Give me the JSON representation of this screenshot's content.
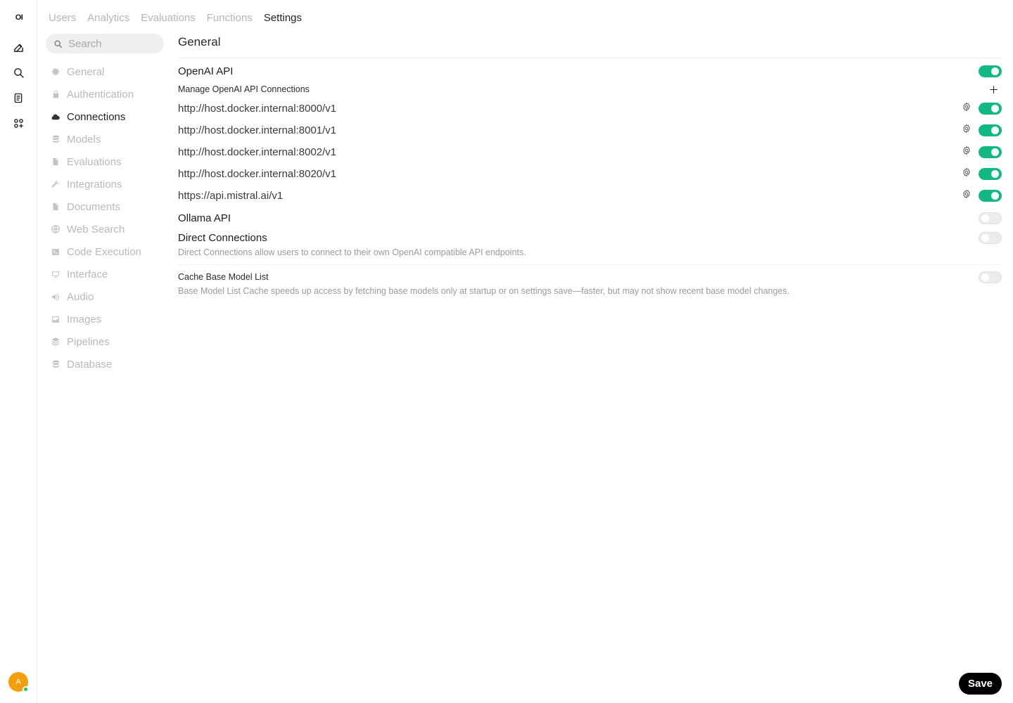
{
  "rail": {
    "logo": "OI",
    "avatar_initial": "A"
  },
  "top_tabs": [
    {
      "label": "Users",
      "active": false
    },
    {
      "label": "Analytics",
      "active": false
    },
    {
      "label": "Evaluations",
      "active": false
    },
    {
      "label": "Functions",
      "active": false
    },
    {
      "label": "Settings",
      "active": true
    }
  ],
  "search": {
    "placeholder": "Search"
  },
  "nav": [
    {
      "label": "General",
      "icon": "gear-icon",
      "active": false
    },
    {
      "label": "Authentication",
      "icon": "lock-icon",
      "active": false
    },
    {
      "label": "Connections",
      "icon": "cloud-icon",
      "active": true
    },
    {
      "label": "Models",
      "icon": "database-icon",
      "active": false
    },
    {
      "label": "Evaluations",
      "icon": "document-icon",
      "active": false
    },
    {
      "label": "Integrations",
      "icon": "wrench-icon",
      "active": false
    },
    {
      "label": "Documents",
      "icon": "document-icon",
      "active": false
    },
    {
      "label": "Web Search",
      "icon": "globe-icon",
      "active": false
    },
    {
      "label": "Code Execution",
      "icon": "terminal-icon",
      "active": false
    },
    {
      "label": "Interface",
      "icon": "monitor-icon",
      "active": false
    },
    {
      "label": "Audio",
      "icon": "speaker-icon",
      "active": false
    },
    {
      "label": "Images",
      "icon": "image-icon",
      "active": false
    },
    {
      "label": "Pipelines",
      "icon": "layers-icon",
      "active": false
    },
    {
      "label": "Database",
      "icon": "database-icon",
      "active": false
    }
  ],
  "main": {
    "section_title": "General",
    "openai": {
      "label": "OpenAI API",
      "enabled": true,
      "manage_label": "Manage OpenAI API Connections",
      "connections": [
        {
          "url": "http://host.docker.internal:8000/v1",
          "enabled": true
        },
        {
          "url": "http://host.docker.internal:8001/v1",
          "enabled": true
        },
        {
          "url": "http://host.docker.internal:8002/v1",
          "enabled": true
        },
        {
          "url": "http://host.docker.internal:8020/v1",
          "enabled": true
        },
        {
          "url": "https://api.mistral.ai/v1",
          "enabled": true
        }
      ]
    },
    "ollama": {
      "label": "Ollama API",
      "enabled": false
    },
    "direct": {
      "label": "Direct Connections",
      "enabled": false,
      "description": "Direct Connections allow users to connect to their own OpenAI compatible API endpoints."
    },
    "cache": {
      "label": "Cache Base Model List",
      "enabled": false,
      "description": "Base Model List Cache speeds up access by fetching base models only at startup or on settings save—faster, but may not show recent base model changes."
    }
  },
  "save_label": "Save",
  "colors": {
    "accent": "#10b981",
    "save_bg": "#000000",
    "avatar": "#f59e0b",
    "online": "#22c55e"
  }
}
